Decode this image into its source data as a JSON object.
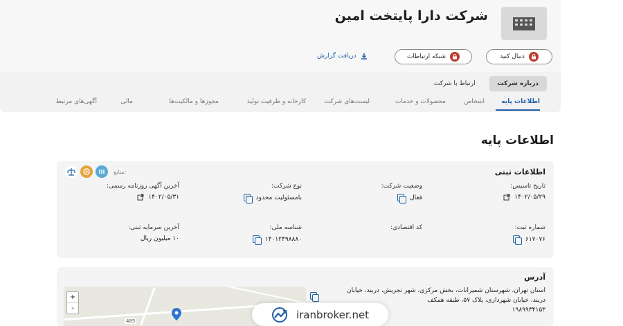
{
  "header": {
    "company_name": "شرکت دارا پایتخت امین",
    "follow_label": "دنبال کنید",
    "network_label": "شبکه ارتباطات",
    "download_label": "دریافت گزارش"
  },
  "top_tabs": [
    {
      "label": "درباره شرکت",
      "active": true
    },
    {
      "label": "ارتباط با شرکت",
      "active": false
    }
  ],
  "sub_tabs": [
    {
      "label": "اطلاعات پایه",
      "active": true
    },
    {
      "label": "اشخاص",
      "active": false
    },
    {
      "label": "محصولات و خدمات",
      "active": false
    },
    {
      "label": "لیست‌های شرکت",
      "active": false
    },
    {
      "label": "کارخانه و ظرفیت تولید",
      "active": false
    },
    {
      "label": "مجوزها و مالکیت‌ها",
      "active": false
    },
    {
      "label": "مالی",
      "active": false
    },
    {
      "label": "آگهی‌های مرتبط",
      "active": false
    }
  ],
  "section_title": "اطلاعات پایه",
  "registration": {
    "title": "اطلاعات ثبتی",
    "sources_label": "منابع:",
    "fields": [
      {
        "label": "تاریخ تاسیس:",
        "value": "۱۴۰۲/۰۵/۲۹"
      },
      {
        "label": "وضعیت شرکت:",
        "value": "فعال"
      },
      {
        "label": "نوع شرکت:",
        "value": "بامسئولیت محدود"
      },
      {
        "label": "آخرین آگهی روزنامه رسمی:",
        "value": "۱۴۰۲/۰۵/۳۱"
      },
      {
        "label": "شماره ثبت:",
        "value": "۶۱۷۰۷۶"
      },
      {
        "label": "کد اقتصادی:",
        "value": ""
      },
      {
        "label": "شناسه ملی:",
        "value": "۱۴۰۱۲۴۹۸۸۸۰"
      },
      {
        "label": "آخرین سرمایه ثبتی:",
        "value": "۱۰ میلیون ریال"
      }
    ]
  },
  "address": {
    "title": "آدرس",
    "text": "استان تهران، شهرستان شمیرانات، بخش مرکزی، شهر تجریش، دربند، خیابان دربند، خیابان شهرداری، پلاک ۵۷، طبقه همکف",
    "postal_code": "۱۹۸۹۹۳۴۱۵۳",
    "map_zoom_in": "+",
    "map_zoom_out": "-",
    "map_road_label": "485"
  },
  "watermark": {
    "text": "iranbroker.net"
  },
  "colors": {
    "accent": "#1e5fa8",
    "lock": "#c0392b"
  }
}
